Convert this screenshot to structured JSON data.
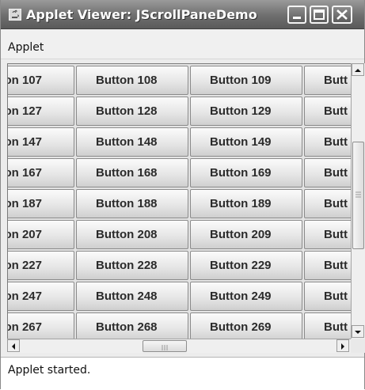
{
  "window": {
    "title": "Applet Viewer: JScrollPaneDemo",
    "controls": {
      "minimize": "minimize-icon",
      "maximize": "maximize-icon",
      "close": "close-icon"
    }
  },
  "menubar": {
    "items": [
      "Applet"
    ]
  },
  "grid": {
    "columns": [
      "Button",
      "Button",
      "Button",
      "Button"
    ],
    "rows": [
      [
        "on 107",
        "Button 108",
        "Button 109",
        "Butt"
      ],
      [
        "on 127",
        "Button 128",
        "Button 129",
        "Butt"
      ],
      [
        "on 147",
        "Button 148",
        "Button 149",
        "Butt"
      ],
      [
        "on 167",
        "Button 168",
        "Button 169",
        "Butt"
      ],
      [
        "on 187",
        "Button 188",
        "Button 189",
        "Butt"
      ],
      [
        "on 207",
        "Button 208",
        "Button 209",
        "Butt"
      ],
      [
        "on 227",
        "Button 228",
        "Button 229",
        "Butt"
      ],
      [
        "on 247",
        "Button 248",
        "Button 249",
        "Butt"
      ],
      [
        "on 267",
        "Button 268",
        "Button 269",
        "Butt"
      ]
    ]
  },
  "status": {
    "text": "Applet started."
  }
}
